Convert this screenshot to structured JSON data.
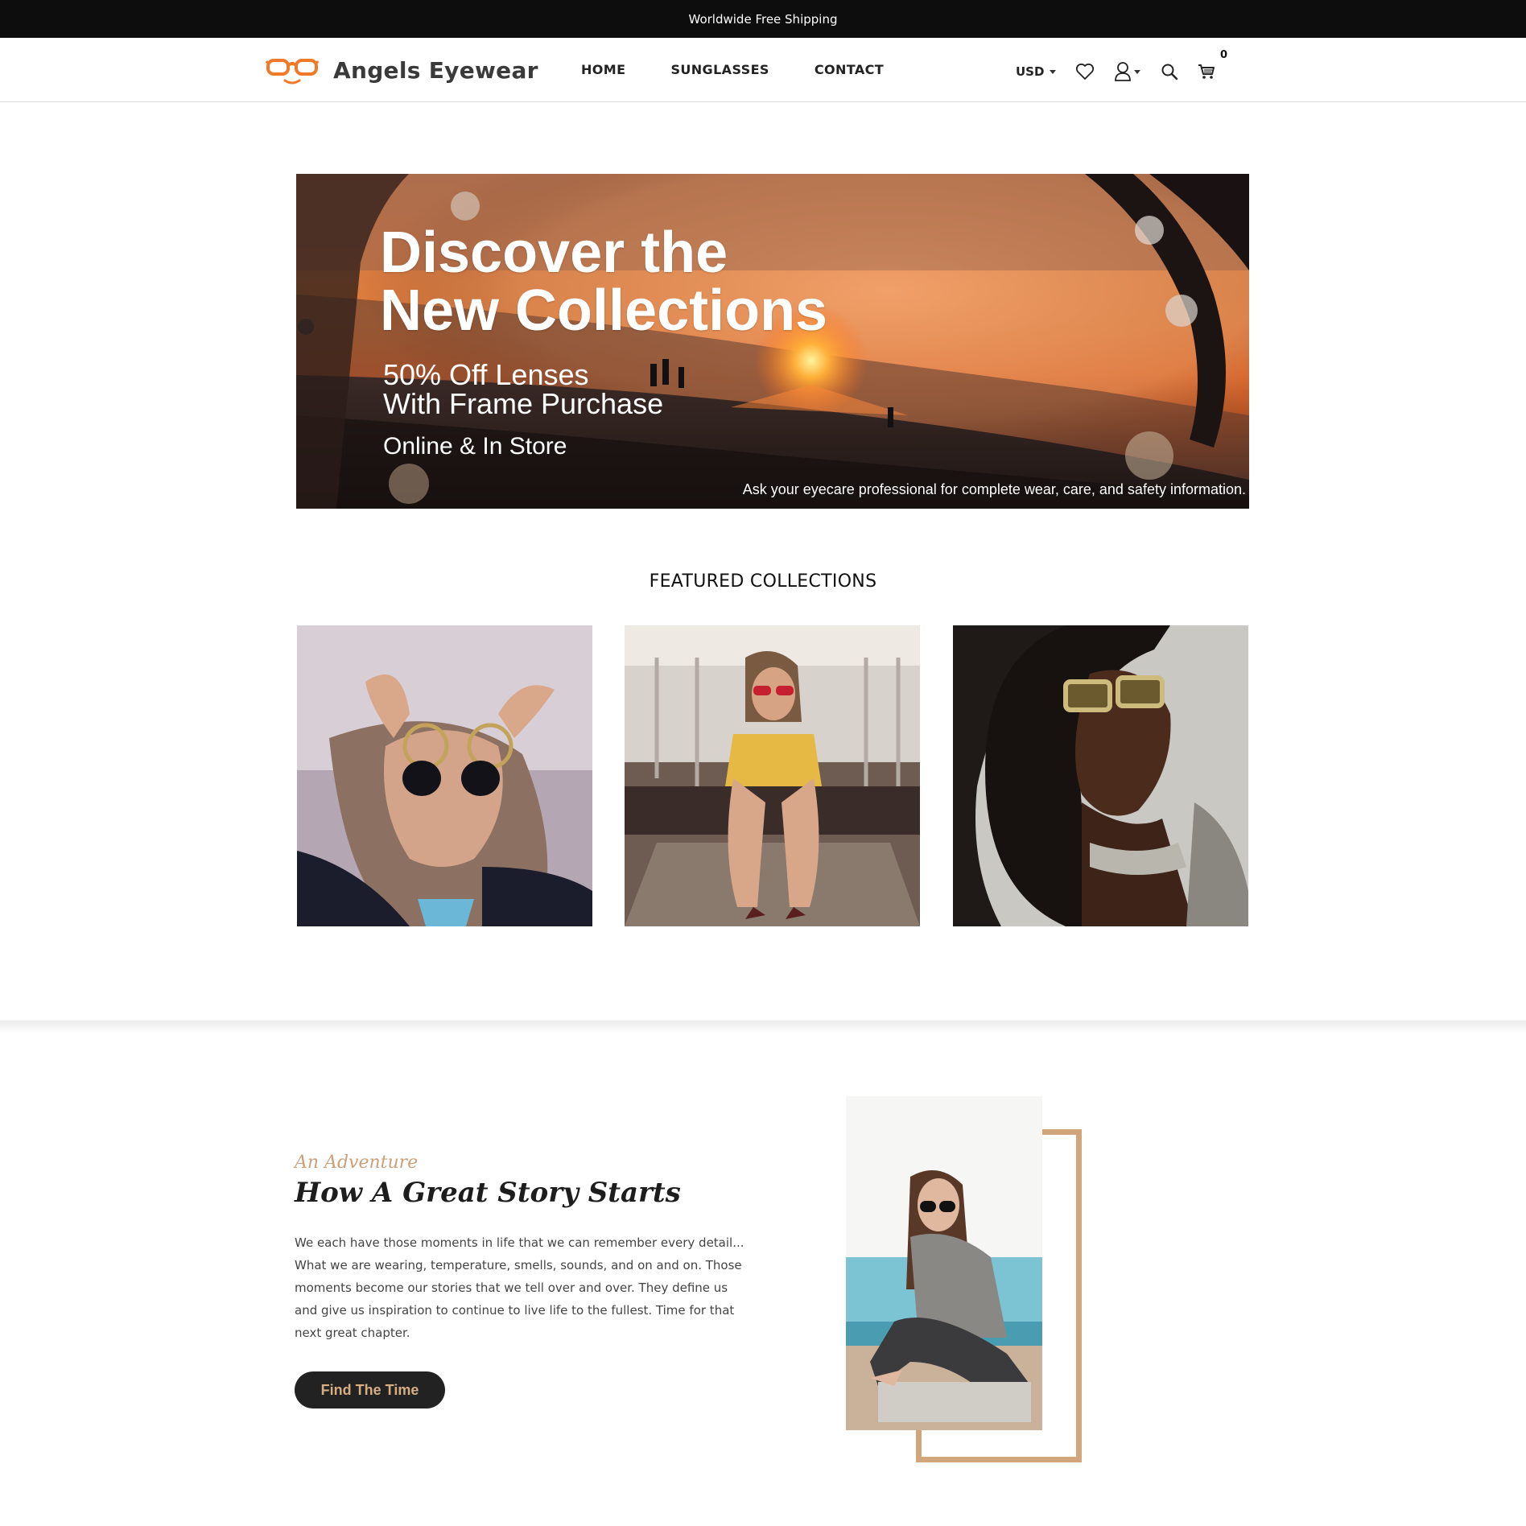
{
  "announcement": {
    "text": "Worldwide Free Shipping"
  },
  "header": {
    "brand": "Angels Eyewear",
    "nav": [
      {
        "label": "HOME"
      },
      {
        "label": "SUNGLASSES"
      },
      {
        "label": "CONTACT"
      }
    ],
    "currency": "USD",
    "cart_count": "0",
    "icons": [
      "heart-icon",
      "user-icon",
      "search-icon",
      "cart-icon"
    ]
  },
  "hero": {
    "title_line1": "Discover the",
    "title_line2": "New Collections",
    "sub_line1": "50% Off Lenses",
    "sub_line2": "With Frame Purchase",
    "availability": "Online & In Store",
    "disclaimer": "Ask your eyecare professional for complete wear, care, and safety information."
  },
  "featured": {
    "title": "FEATURED COLLECTIONS"
  },
  "story": {
    "eyebrow": "An Adventure",
    "title": "How A Great Story Starts",
    "body": "We each have those moments in life that we can remember every detail... What we are wearing, temperature, smells, sounds, and on and on. Those moments become our stories that we tell over and over. They define us and give us inspiration to continue to live life to the fullest. Time for that next great chapter.",
    "button_label": "Find The Time"
  },
  "colors": {
    "accent": "#d2a67b",
    "logo_orange": "#f07a2a",
    "dark": "#222222"
  }
}
